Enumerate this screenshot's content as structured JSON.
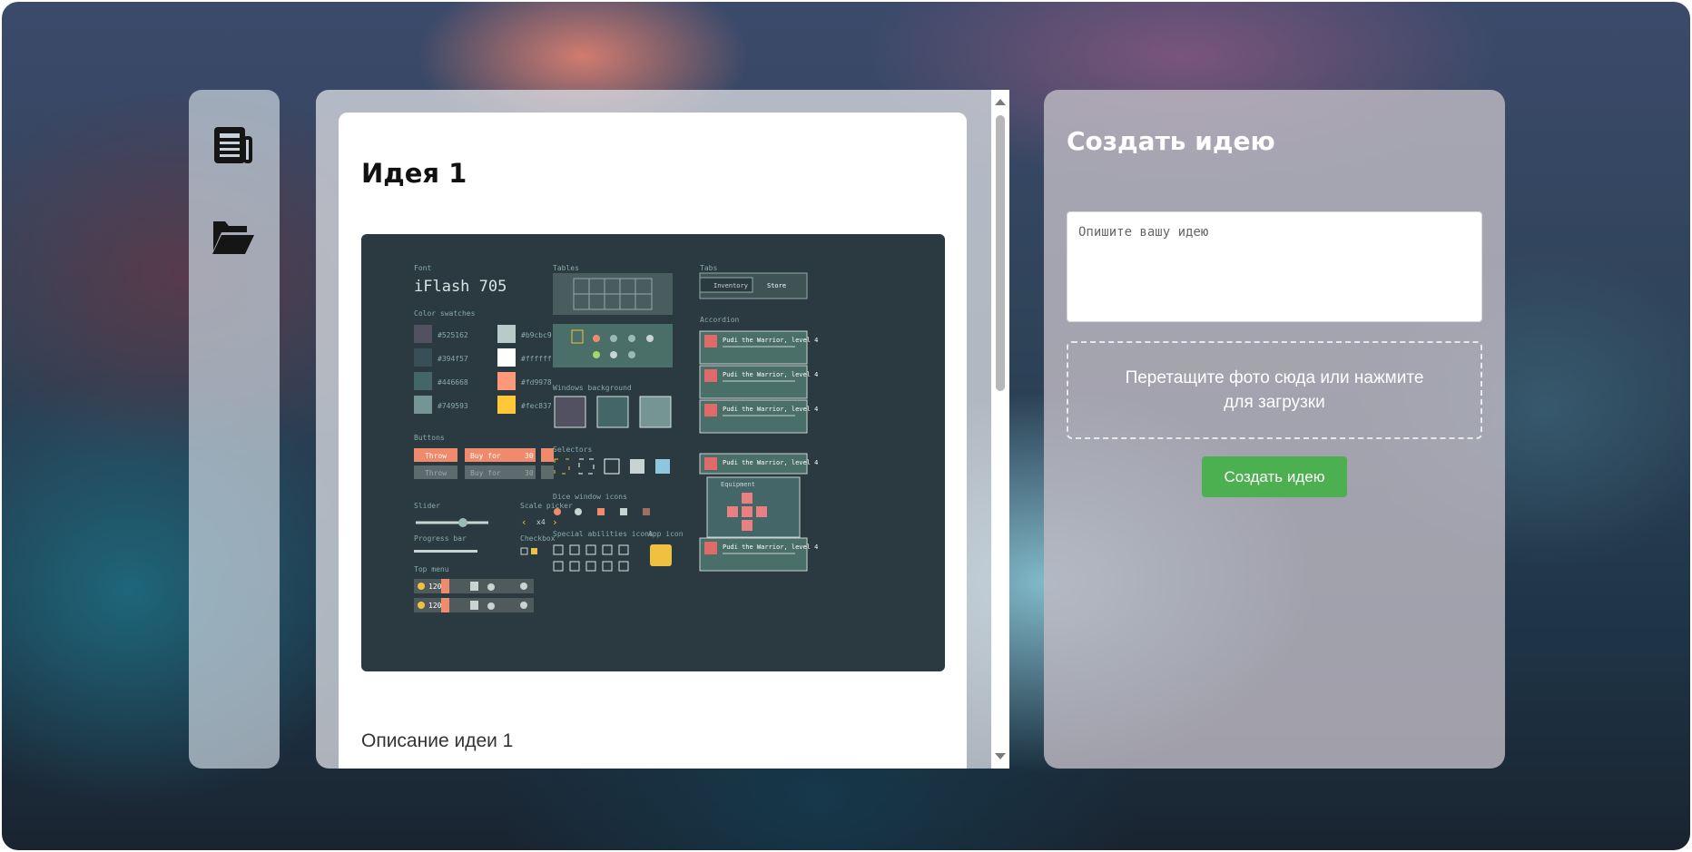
{
  "sidebar": {
    "items": [
      {
        "icon": "newspaper-icon"
      },
      {
        "icon": "folder-open-icon"
      }
    ]
  },
  "feed": {
    "ideas": [
      {
        "title": "Идея 1",
        "description": "Описание идеи 1",
        "image": {
          "font_label": "Font",
          "font_name": "iFlash 705",
          "swatches_label": "Color swatches",
          "swatches": [
            {
              "hex": "#525162",
              "color": "#525162"
            },
            {
              "hex": "#b9cbc9",
              "color": "#b9cbc9"
            },
            {
              "hex": "#394f57",
              "color": "#394f57"
            },
            {
              "hex": "#ffffff",
              "color": "#ffffff"
            },
            {
              "hex": "#446668",
              "color": "#446668"
            },
            {
              "hex": "#fd9978",
              "color": "#fd9978"
            },
            {
              "hex": "#749593",
              "color": "#749593"
            },
            {
              "hex": "#fec837",
              "color": "#fec837"
            }
          ],
          "buttons_label": "Buttons",
          "throw_label": "Throw",
          "buy_label": "Buy for",
          "buy_price": "30",
          "slider_label": "Slider",
          "scale_picker_label": "Scale picker",
          "scale_value": "x4",
          "progress_label": "Progress bar",
          "checkbox_label": "Checkbox",
          "top_menu_label": "Top menu",
          "top_menu_value": "120",
          "tables_label": "Tables",
          "windows_bg_label": "Windows background",
          "selectors_label": "Selectors",
          "dice_icons_label": "Dice window icons",
          "special_label": "Special abilities icons",
          "app_icon_label": "App icon",
          "tabs_label": "Tabs",
          "tab_inventory": "Inventory",
          "tab_store": "Store",
          "accordion_label": "Accordion",
          "accordion_item": "Pudi the Warrior, level 4",
          "equipment_label": "Equipment"
        }
      }
    ]
  },
  "create": {
    "title": "Создать идею",
    "input_placeholder": "Опишите вашу идею",
    "input_value": "",
    "dropzone_text": "Перетащите фото сюда или нажмите для загрузки",
    "submit_label": "Создать идею"
  }
}
